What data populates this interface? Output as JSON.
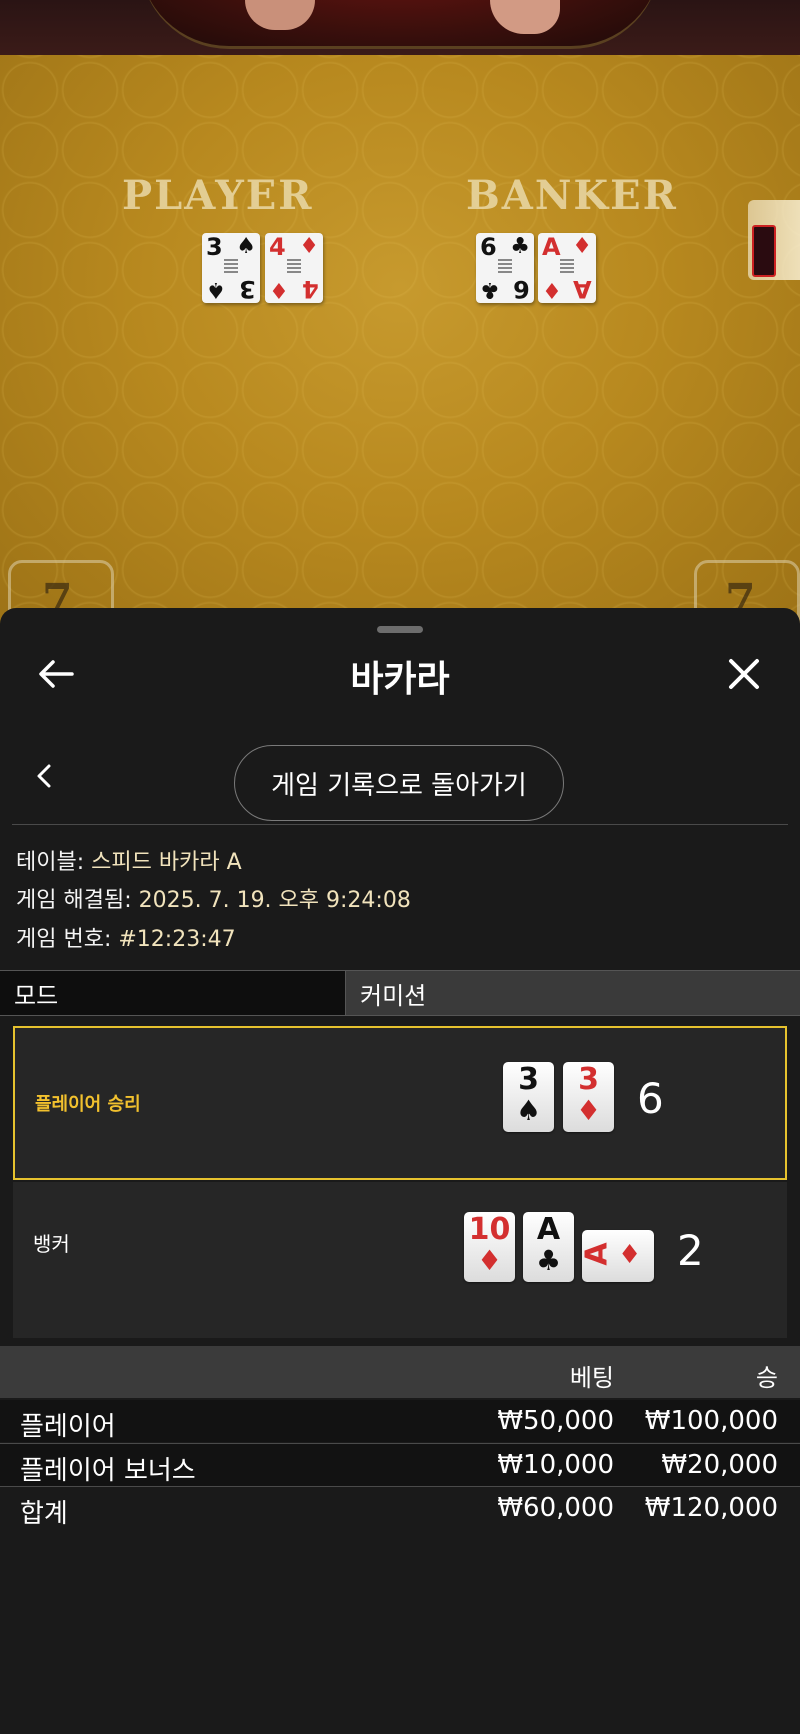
{
  "table": {
    "player_label": "PLAYER",
    "banker_label": "BANKER",
    "player_cards": [
      {
        "rank": "3",
        "suit": "♠",
        "color": "black"
      },
      {
        "rank": "4",
        "suit": "♦",
        "color": "red"
      }
    ],
    "banker_cards": [
      {
        "rank": "6",
        "suit": "♣",
        "color": "black"
      },
      {
        "rank": "A",
        "suit": "♦",
        "color": "red"
      }
    ],
    "seat_left": "7",
    "seat_right": "7"
  },
  "header": {
    "title": "바카라",
    "back_icon": "arrow-left-icon",
    "close_icon": "close-icon"
  },
  "nav": {
    "chevron_icon": "chevron-left-icon",
    "back_to_history_label": "게임 기록으로 돌아가기"
  },
  "info": {
    "table_label": "테이블:",
    "table_value": "스피드 바카라 A",
    "resolved_label": "게임 해결됨:",
    "resolved_value": "2025. 7. 19. 오후 9:24:08",
    "game_no_label": "게임 번호:",
    "game_no_value": "#12:23:47"
  },
  "tabs": {
    "mode": "모드",
    "commission": "커미션"
  },
  "results": {
    "player": {
      "label": "플레이어 승리",
      "score": "6",
      "cards": [
        {
          "rank": "3",
          "suit": "♠",
          "color": "black"
        },
        {
          "rank": "3",
          "suit": "♦",
          "color": "red"
        }
      ]
    },
    "banker": {
      "label": "뱅커",
      "score": "2",
      "cards": [
        {
          "rank": "10",
          "suit": "♦",
          "color": "red"
        },
        {
          "rank": "A",
          "suit": "♣",
          "color": "black"
        },
        {
          "rank": "A",
          "suit": "♦",
          "color": "red",
          "sideways": true
        }
      ]
    }
  },
  "bets": {
    "col_bet": "베팅",
    "col_win": "승",
    "rows": [
      {
        "name": "플레이어",
        "bet": "₩50,000",
        "win": "₩100,000"
      },
      {
        "name": "플레이어 보너스",
        "bet": "₩10,000",
        "win": "₩20,000"
      }
    ],
    "total": {
      "name": "합계",
      "bet": "₩60,000",
      "win": "₩120,000"
    }
  },
  "colors": {
    "accent_gold": "#e6c22e",
    "card_red": "#d32f2f",
    "panel_bg": "#1a1a1a"
  }
}
